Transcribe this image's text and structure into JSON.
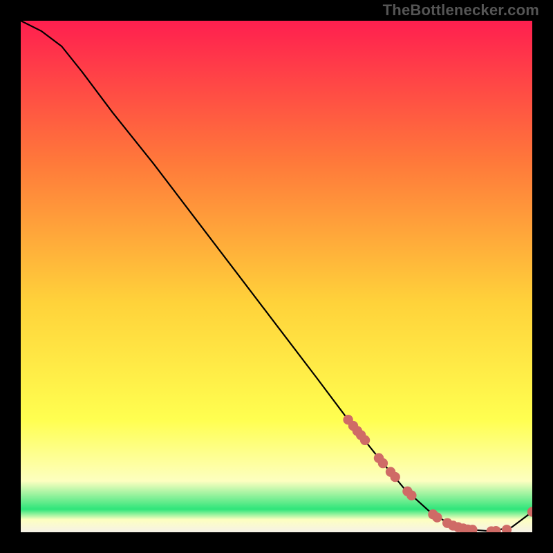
{
  "watermark": "TheBottlenecker.com",
  "colors": {
    "gradient_top": "#ff1f4f",
    "gradient_mid_upper": "#ff7a3a",
    "gradient_mid": "#ffd23a",
    "gradient_mid_lower": "#ffff50",
    "gradient_lower": "#fdffc0",
    "gradient_green": "#2ee57a",
    "curve": "#000000",
    "marker_fill": "#cf6b66",
    "marker_stroke": "#b75a55"
  },
  "chart_data": {
    "type": "line",
    "title": "",
    "xlabel": "",
    "ylabel": "",
    "xlim": [
      0,
      100
    ],
    "ylim": [
      0,
      100
    ],
    "curve": {
      "x": [
        0,
        4,
        8,
        12,
        18,
        26,
        34,
        42,
        50,
        58,
        64,
        70,
        75,
        80,
        84,
        88,
        92,
        96,
        100
      ],
      "y": [
        100,
        98,
        95,
        90,
        82,
        72,
        61.5,
        51,
        40.5,
        30,
        22,
        14.5,
        8.5,
        4,
        1.5,
        0.5,
        0.2,
        1,
        4
      ]
    },
    "markers": {
      "x": [
        64,
        65,
        65.8,
        66.5,
        67.3,
        70,
        70.8,
        72.3,
        73.2,
        75.6,
        76.4,
        80.6,
        81.4,
        83.4,
        84.5,
        85.5,
        86.5,
        87.4,
        88.3,
        92,
        92.9,
        95,
        100
      ],
      "y": [
        22,
        20.8,
        19.8,
        19,
        18,
        14.5,
        13.5,
        11.8,
        10.8,
        8,
        7.2,
        3.5,
        2.9,
        1.8,
        1.3,
        1,
        0.75,
        0.55,
        0.5,
        0.2,
        0.25,
        0.5,
        4
      ]
    }
  }
}
